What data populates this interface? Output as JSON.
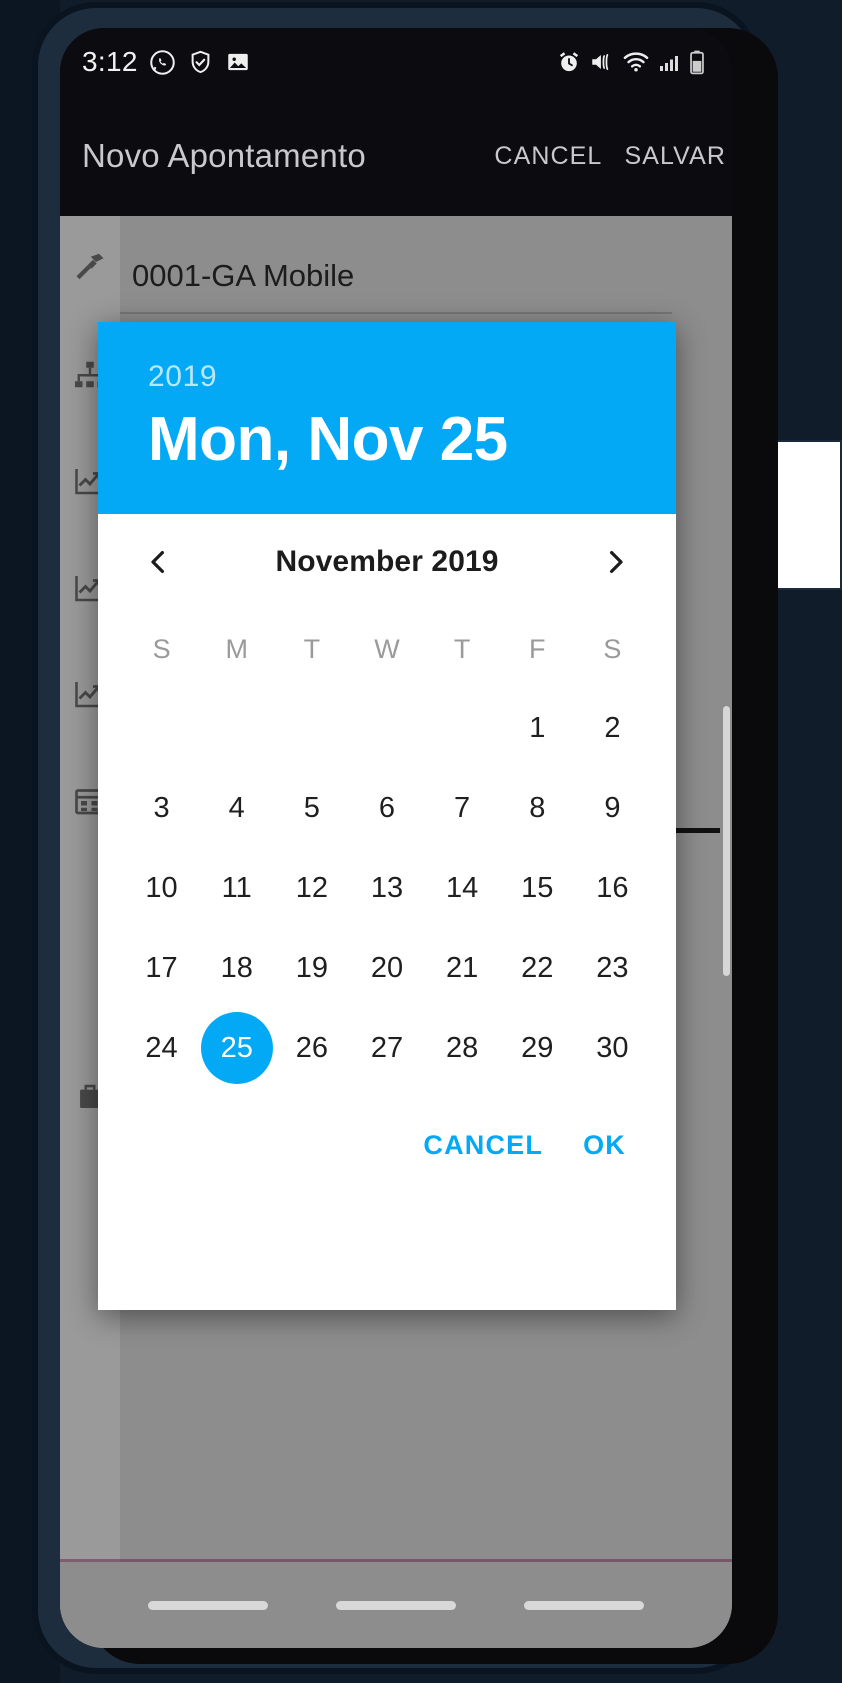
{
  "status_bar": {
    "time": "3:12",
    "left_icons": [
      "whatsapp-icon",
      "shield-check-icon",
      "image-icon"
    ],
    "right_icons": [
      "alarm-icon",
      "volume-mute-icon",
      "wifi-icon",
      "signal-icon",
      "battery-icon"
    ]
  },
  "app_bar": {
    "title": "Novo Apontamento",
    "cancel_label": "CANCEL",
    "save_label": "SALVAR"
  },
  "form": {
    "project_field_value": "0001-GA Mobile"
  },
  "sidebar": {
    "items": [
      {
        "icon": "hammer-icon"
      },
      {
        "icon": "hierarchy-icon"
      },
      {
        "icon": "chart-line-icon"
      },
      {
        "icon": "chart-line-icon"
      },
      {
        "icon": "chart-line-icon"
      },
      {
        "icon": "calendar-icon"
      },
      {
        "icon": "briefcase-icon"
      }
    ]
  },
  "date_picker": {
    "header_year": "2019",
    "header_date": "Mon, Nov 25",
    "month_label": "November 2019",
    "prev_icon": "chevron-left-icon",
    "next_icon": "chevron-right-icon",
    "weekdays": [
      "S",
      "M",
      "T",
      "W",
      "T",
      "F",
      "S"
    ],
    "selected_day": 25,
    "days": [
      "",
      "",
      "",
      "",
      "",
      "1",
      "2",
      "3",
      "4",
      "5",
      "6",
      "7",
      "8",
      "9",
      "10",
      "11",
      "12",
      "13",
      "14",
      "15",
      "16",
      "17",
      "18",
      "19",
      "20",
      "21",
      "22",
      "23",
      "24",
      "25",
      "26",
      "27",
      "28",
      "29",
      "30"
    ],
    "cancel_label": "CANCEL",
    "ok_label": "OK",
    "accent_color": "#03a9f4",
    "header_text_color": "#ffffff"
  }
}
